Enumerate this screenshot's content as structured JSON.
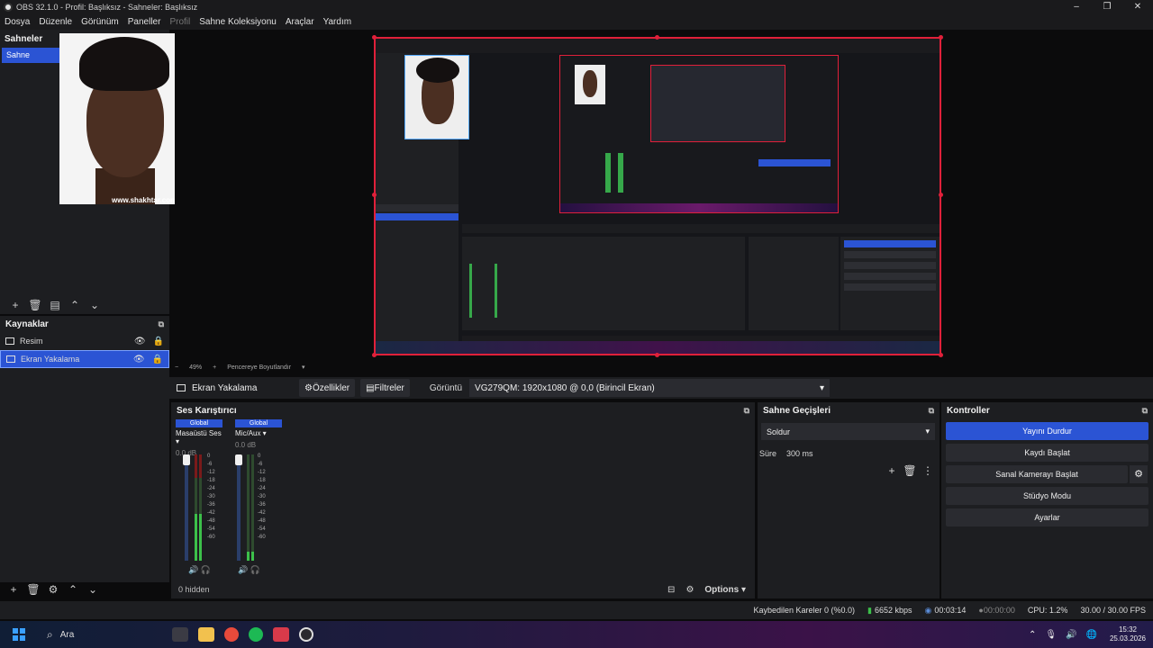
{
  "window": {
    "title": "OBS 32.1.0 - Profil: Başlıksız - Sahneler: Başlıksız",
    "controls": [
      "–",
      "❐",
      "✕"
    ]
  },
  "menu": [
    {
      "label": "Dosya"
    },
    {
      "label": "Düzenle"
    },
    {
      "label": "Görünüm"
    },
    {
      "label": "Paneller"
    },
    {
      "label": "Profil",
      "disabled": true
    },
    {
      "label": "Sahne Koleksiyonu"
    },
    {
      "label": "Araçlar"
    },
    {
      "label": "Yardım"
    }
  ],
  "scenes": {
    "title": "Sahneler",
    "items": [
      "Sahne"
    ],
    "watermark": "www.shakhtar.com"
  },
  "sources": {
    "title": "Kaynaklar",
    "items": [
      {
        "label": "Resim"
      },
      {
        "label": "Ekran Yakalama",
        "selected": true
      }
    ]
  },
  "preview": {
    "zoom": "49%",
    "fit_label": "Pencereye Boyutlandır"
  },
  "context": {
    "source_name": "Ekran Yakalama",
    "properties_label": "Özellikler",
    "filters_label": "Filtreler",
    "display_label": "Görüntü",
    "display_value": "VG279QM: 1920x1080 @ 0,0 (Birincil Ekran)"
  },
  "mixer": {
    "title": "Ses Karıştırıcı",
    "channels": [
      {
        "badge": "Global",
        "name": "Masaüstü Ses",
        "db": "0.0 dB"
      },
      {
        "badge": "Global",
        "name": "Mic/Aux",
        "db": "0.0 dB"
      }
    ],
    "scale": [
      "0",
      "-6",
      "-12",
      "-18",
      "-24",
      "-30",
      "-36",
      "-42",
      "-48",
      "-54",
      "-60"
    ],
    "hidden_label": "0 hidden",
    "options_label": "Options"
  },
  "transitions": {
    "title": "Sahne Geçişleri",
    "selected": "Soldur",
    "duration_label": "Süre",
    "duration_value": "300 ms"
  },
  "controls": {
    "title": "Kontroller",
    "stop_stream": "Yayını Durdur",
    "start_record": "Kaydı Başlat",
    "start_virtualcam": "Sanal Kamerayı Başlat",
    "studio_mode": "Stüdyo Modu",
    "settings": "Ayarlar"
  },
  "status": {
    "dropped": "Kaybedilen Kareler 0 (%0.0)",
    "bitrate": "6652 kbps",
    "stream_time": "00:03:14",
    "rec_time": "00:00:00",
    "cpu": "CPU: 1.2%",
    "fps": "30.00 / 30.00 FPS"
  },
  "taskbar": {
    "search_placeholder": "Ara",
    "time": "15:32",
    "date": "25.03.2026"
  },
  "colors": {
    "accent": "#2b54d4",
    "selection_border": "#e0203a",
    "meter_green": "#3cc04a"
  }
}
